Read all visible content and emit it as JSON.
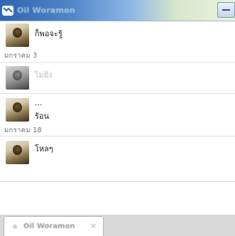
{
  "window": {
    "title": "Oil Woramon",
    "minimize_icon": "minimize-icon",
    "chat_icon": "chat-bubble-icon"
  },
  "messages": [
    {
      "text": "ก็พอจะรู้",
      "faded": false
    },
    {
      "text": "ไม่ยัง",
      "faded": true
    },
    {
      "text": "...",
      "faded": false
    },
    {
      "text": "ร้อน",
      "faded": false
    },
    {
      "text": "โหลๆ",
      "faded": false
    }
  ],
  "dates": [
    "มกราคม 3",
    "มกราคม 18"
  ],
  "tab": {
    "label": "Oil Woramon",
    "close": "×"
  },
  "colors": {
    "titlebar_start": "#2e66b0",
    "titlebar_end": "#eaf3df",
    "divider": "#e3e3e3",
    "tabbar": "#d9d9d9"
  }
}
